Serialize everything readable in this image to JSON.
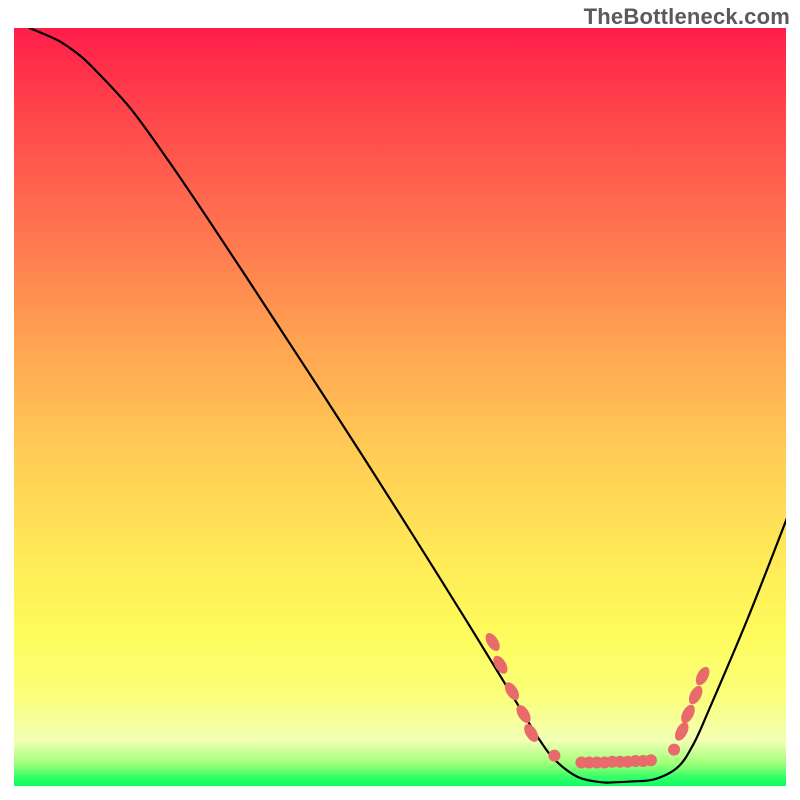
{
  "watermark": "TheBottleneck.com",
  "colors": {
    "curve": "#000000",
    "dots": "#e86a6a",
    "gradient_top": "#ff1d4a",
    "gradient_bottom": "#0cff60"
  },
  "chart_data": {
    "type": "line",
    "title": "",
    "xlabel": "",
    "ylabel": "",
    "xlim": [
      0,
      100
    ],
    "ylim": [
      0,
      100
    ],
    "x": [
      2,
      4,
      6,
      8,
      10,
      15,
      20,
      25,
      30,
      35,
      40,
      45,
      50,
      55,
      58,
      60,
      63,
      66,
      68,
      70,
      73,
      76,
      78,
      80,
      83,
      86,
      88,
      90,
      95,
      100
    ],
    "values": [
      100,
      99.2,
      98.2,
      96.8,
      95,
      89.5,
      82.5,
      75,
      67.3,
      59.5,
      51.7,
      43.8,
      35.8,
      27.7,
      22.8,
      19.5,
      14.5,
      9.5,
      6.2,
      3.5,
      1.2,
      0.5,
      0.5,
      0.6,
      0.9,
      2.5,
      5.5,
      10,
      22,
      35
    ],
    "series": [
      {
        "name": "bottleneck-curve",
        "x": [
          2,
          4,
          6,
          8,
          10,
          15,
          20,
          25,
          30,
          35,
          40,
          45,
          50,
          55,
          58,
          60,
          63,
          66,
          68,
          70,
          73,
          76,
          78,
          80,
          83,
          86,
          88,
          90,
          95,
          100
        ],
        "values": [
          100,
          99.2,
          98.2,
          96.8,
          95,
          89.5,
          82.5,
          75,
          67.3,
          59.5,
          51.7,
          43.8,
          35.8,
          27.7,
          22.8,
          19.5,
          14.5,
          9.5,
          6.2,
          3.5,
          1.2,
          0.5,
          0.5,
          0.6,
          0.9,
          2.5,
          5.5,
          10,
          22,
          35
        ]
      }
    ],
    "markers": [
      {
        "x": 62,
        "y": 19
      },
      {
        "x": 63,
        "y": 16
      },
      {
        "x": 64.5,
        "y": 12.5
      },
      {
        "x": 66,
        "y": 9.5
      },
      {
        "x": 67,
        "y": 7
      },
      {
        "x": 70,
        "y": 4
      },
      {
        "x": 73.5,
        "y": 3.1
      },
      {
        "x": 74.5,
        "y": 3.1
      },
      {
        "x": 75.5,
        "y": 3.1
      },
      {
        "x": 76.5,
        "y": 3.1
      },
      {
        "x": 77.5,
        "y": 3.2
      },
      {
        "x": 78.5,
        "y": 3.2
      },
      {
        "x": 79.5,
        "y": 3.2
      },
      {
        "x": 80.5,
        "y": 3.3
      },
      {
        "x": 81.5,
        "y": 3.3
      },
      {
        "x": 82.5,
        "y": 3.4
      },
      {
        "x": 85.5,
        "y": 4.8
      },
      {
        "x": 86.5,
        "y": 7.2
      },
      {
        "x": 87.3,
        "y": 9.5
      },
      {
        "x": 88.3,
        "y": 12
      },
      {
        "x": 89.2,
        "y": 14.5
      }
    ]
  }
}
